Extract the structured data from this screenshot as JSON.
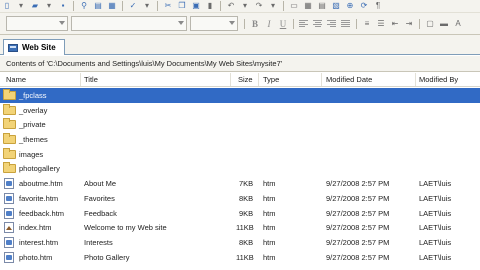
{
  "window": {
    "tab_label": "Web Site",
    "path": "Contents of 'C:\\Documents and Settings\\luis\\My Documents\\My Web Sites\\mysite7'"
  },
  "toolbar": {
    "format_buttons": [
      "B",
      "I",
      "U"
    ]
  },
  "columns": {
    "name": "Name",
    "title": "Title",
    "size": "Size",
    "type": "Type",
    "modified_date": "Modified Date",
    "modified_by": "Modified By"
  },
  "rows": [
    {
      "icon": "folder-icon",
      "name": "_fpclass",
      "title": "",
      "size": "",
      "type": "",
      "date": "",
      "by": ""
    },
    {
      "icon": "folder-icon",
      "name": "_overlay",
      "title": "",
      "size": "",
      "type": "",
      "date": "",
      "by": ""
    },
    {
      "icon": "folder-icon",
      "name": "_private",
      "title": "",
      "size": "",
      "type": "",
      "date": "",
      "by": ""
    },
    {
      "icon": "folder-icon",
      "name": "_themes",
      "title": "",
      "size": "",
      "type": "",
      "date": "",
      "by": ""
    },
    {
      "icon": "folder-icon",
      "name": "images",
      "title": "",
      "size": "",
      "type": "",
      "date": "",
      "by": ""
    },
    {
      "icon": "folder-icon",
      "name": "photogallery",
      "title": "",
      "size": "",
      "type": "",
      "date": "",
      "by": ""
    },
    {
      "icon": "page-icon",
      "name": "aboutme.htm",
      "title": "About Me",
      "size": "7KB",
      "type": "htm",
      "date": "9/27/2008 2:57 PM",
      "by": "LAET\\luis"
    },
    {
      "icon": "page-icon",
      "name": "favorite.htm",
      "title": "Favorites",
      "size": "8KB",
      "type": "htm",
      "date": "9/27/2008 2:57 PM",
      "by": "LAET\\luis"
    },
    {
      "icon": "page-icon",
      "name": "feedback.htm",
      "title": "Feedback",
      "size": "9KB",
      "type": "htm",
      "date": "9/27/2008 2:57 PM",
      "by": "LAET\\luis"
    },
    {
      "icon": "home-page-icon",
      "name": "index.htm",
      "title": "Welcome to my Web site",
      "size": "11KB",
      "type": "htm",
      "date": "9/27/2008 2:57 PM",
      "by": "LAET\\luis"
    },
    {
      "icon": "page-icon",
      "name": "interest.htm",
      "title": "Interests",
      "size": "8KB",
      "type": "htm",
      "date": "9/27/2008 2:57 PM",
      "by": "LAET\\luis"
    },
    {
      "icon": "page-icon",
      "name": "photo.htm",
      "title": "Photo Gallery",
      "size": "11KB",
      "type": "htm",
      "date": "9/27/2008 2:57 PM",
      "by": "LAET\\luis"
    }
  ],
  "selected_row": 0,
  "colors": {
    "selection": "#316ac5",
    "toolbar_bg": "#f4f3ee"
  }
}
